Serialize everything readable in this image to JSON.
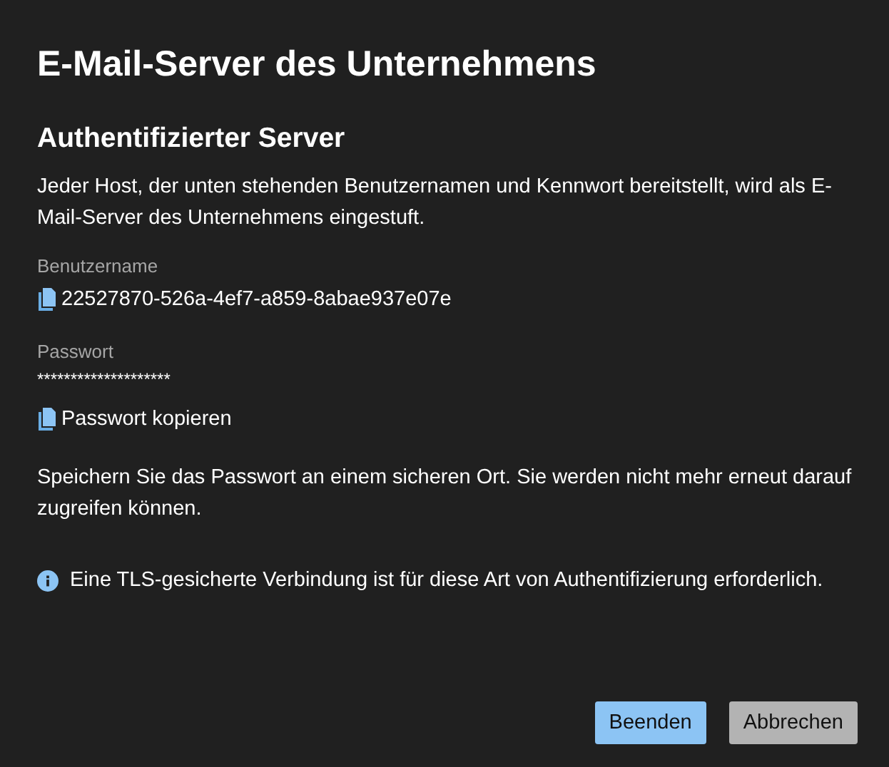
{
  "dialog": {
    "title": "E-Mail-Server des Unternehmens"
  },
  "section": {
    "heading": "Authentifizierter Server",
    "description": "Jeder Host, der unten stehenden Benutzernamen und Kennwort bereitstellt, wird als E-Mail-Server des Unternehmens eingestuft."
  },
  "username": {
    "label": "Benutzername",
    "value": "22527870-526a-4ef7-a859-8abae937e07e"
  },
  "password": {
    "label": "Passwort",
    "value": "********************",
    "copy_link": "Passwort kopieren"
  },
  "warning": "Speichern Sie das Passwort an einem sicheren Ort. Sie werden nicht mehr erneut darauf zugreifen können.",
  "info": "Eine TLS-gesicherte Verbindung ist für diese Art von Authentifizierung erforderlich.",
  "buttons": [
    {
      "label": "Beenden",
      "kind": "primary"
    },
    {
      "label": "Abbrechen",
      "kind": "secondary"
    }
  ]
}
